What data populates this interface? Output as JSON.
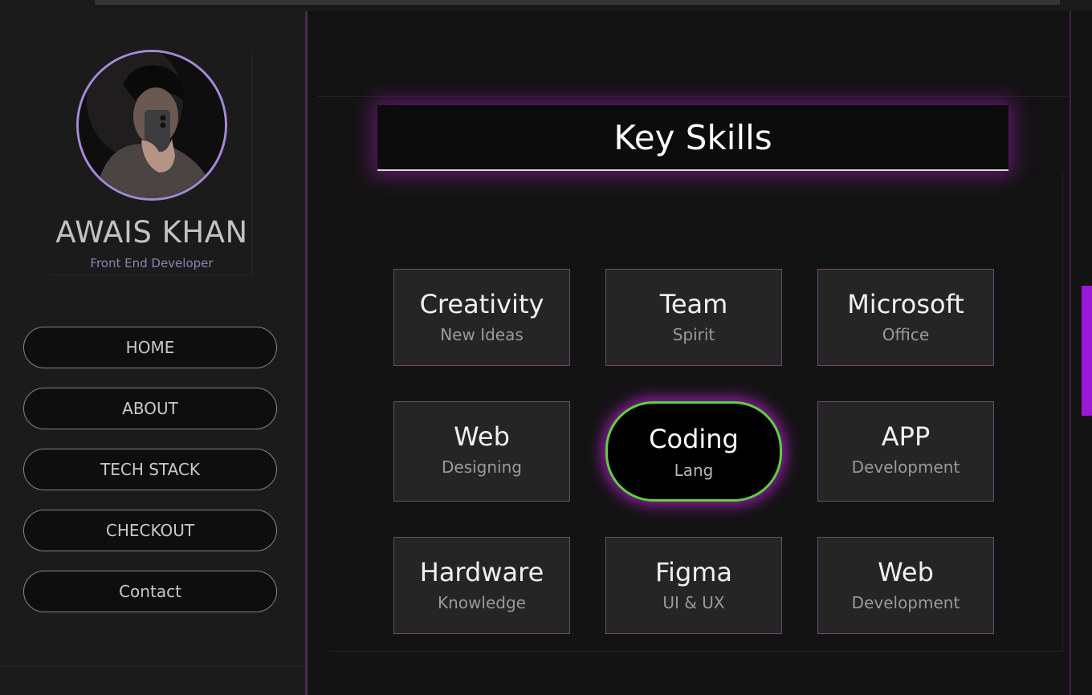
{
  "profile": {
    "name": "AWAIS KHAN",
    "role": "Front End Developer"
  },
  "nav": {
    "items": [
      {
        "label": "HOME"
      },
      {
        "label": "ABOUT"
      },
      {
        "label": "TECH STACK"
      },
      {
        "label": "CHECKOUT"
      },
      {
        "label": "Contact"
      }
    ]
  },
  "skills": {
    "title": "Key Skills",
    "cards": [
      {
        "title": "Creativity",
        "subtitle": "New Ideas"
      },
      {
        "title": "Team",
        "subtitle": "Spirit"
      },
      {
        "title": "Microsoft",
        "subtitle": "Office"
      },
      {
        "title": "Web",
        "subtitle": "Designing"
      },
      {
        "title": "Coding",
        "subtitle": "Lang",
        "active": true
      },
      {
        "title": "APP",
        "subtitle": "Development"
      },
      {
        "title": "Hardware",
        "subtitle": "Knowledge"
      },
      {
        "title": "Figma",
        "subtitle": "UI & UX"
      },
      {
        "title": "Web",
        "subtitle": "Development"
      }
    ]
  },
  "colors": {
    "accent_purple": "#9b19d6",
    "glow_magenta": "#9b1fae",
    "active_border_green": "#5ed03c",
    "avatar_ring": "#a48ad6"
  },
  "icons": [
    "profile-photo"
  ]
}
